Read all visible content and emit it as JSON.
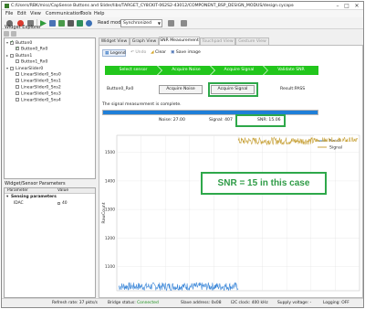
{
  "window": {
    "title": "C:/Users/RBK/misc/CapSense Buttons and Slider/libs/TARGET_CY8CKIT-062S2-43012/COMPONENT_BSP_DESIGN_MODUS/design.cycapsense* - CapSense Tune...",
    "minimize": "–",
    "maximize": "□",
    "close": "✕"
  },
  "menu": [
    "File",
    "Edit",
    "View",
    "Communication",
    "Tools",
    "Help"
  ],
  "toolbar": {
    "read_mode_label": "Read mode:",
    "read_mode_value": "Synchronized",
    "icons": [
      "gear-icon",
      "stop-icon",
      "connect-icon",
      "play-icon",
      "pause-icon",
      "refresh-icon",
      "camera-icon",
      "export-icon",
      "help-icon",
      "undo-icon",
      "redo-icon"
    ]
  },
  "explorer": {
    "title": "Widget Explorer",
    "items": [
      {
        "label": "Button0",
        "level": 0,
        "checked": true,
        "expand": "▾"
      },
      {
        "label": "Button0_Rx0",
        "level": 1,
        "checked": true
      },
      {
        "label": "Button1",
        "level": 0,
        "checked": false,
        "expand": "▸"
      },
      {
        "label": "Button1_Rx0",
        "level": 1,
        "checked": false
      },
      {
        "label": "LinearSlider0",
        "level": 0,
        "checked": false,
        "expand": "▾"
      },
      {
        "label": "LinearSlider0_Sns0",
        "level": 1,
        "checked": false
      },
      {
        "label": "LinearSlider0_Sns1",
        "level": 1,
        "checked": false
      },
      {
        "label": "LinearSlider0_Sns2",
        "level": 1,
        "checked": false
      },
      {
        "label": "LinearSlider0_Sns3",
        "level": 1,
        "checked": false
      },
      {
        "label": "LinearSlider0_Sns4",
        "level": 1,
        "checked": false
      }
    ]
  },
  "params": {
    "title": "Widget/Sensor Parameters",
    "col_param": "Parameter",
    "col_value": "Value",
    "section": "Sensing parameters",
    "row_name": "IDAC",
    "row_value": "40"
  },
  "tabs": [
    {
      "label": "Widget View",
      "state": "normal"
    },
    {
      "label": "Graph View",
      "state": "normal"
    },
    {
      "label": "SNR Measurement",
      "state": "active"
    },
    {
      "label": "Touchpad View",
      "state": "disabled"
    },
    {
      "label": "Gesture View",
      "state": "disabled"
    }
  ],
  "sub_toolbar": {
    "legend": "Legend",
    "undo": "Undo",
    "clear": "Clear",
    "save": "Save image"
  },
  "steps": [
    "Select sensor",
    "Acquire Noise",
    "Acquire Signal",
    "Validate SNR"
  ],
  "measurement": {
    "sensor": "Button0_Rx0",
    "acquire_noise": "Acquire Noise",
    "acquire_signal": "Acquire Signal",
    "result": "Result:PASS",
    "message": "The signal measurement is complete.",
    "progress_fraction": 1.0,
    "noise": "Noise: 27.00",
    "signal": "Signal: 407",
    "snr": "SNR: 15.06"
  },
  "annotation": "SNR = 15 in this case",
  "chart_data": {
    "type": "line",
    "ylabel": "RawCount",
    "yticks": [
      1000,
      1100,
      1200,
      1300,
      1400,
      1500
    ],
    "ylim": [
      1015,
      1560
    ],
    "legend_position": "top-right",
    "series": [
      {
        "name": "Noise",
        "color": "#3a86d8",
        "x_range": [
          0.0,
          0.5
        ],
        "y_base": 1030,
        "y_noise": 14
      },
      {
        "name": "Signal",
        "color": "#c8a23a",
        "x_range": [
          0.5,
          1.0
        ],
        "y_base": 1540,
        "y_noise": 13
      }
    ]
  },
  "status": {
    "refresh": "Refresh rate:  37 pkts/s",
    "bridge_label": "Bridge status:",
    "bridge_value": "Connected",
    "slave": "Slave address:  0x08",
    "i2c": "I2C clock:  400 kHz",
    "supply": "Supply voltage:  -",
    "logging": "Logging:  OFF"
  }
}
